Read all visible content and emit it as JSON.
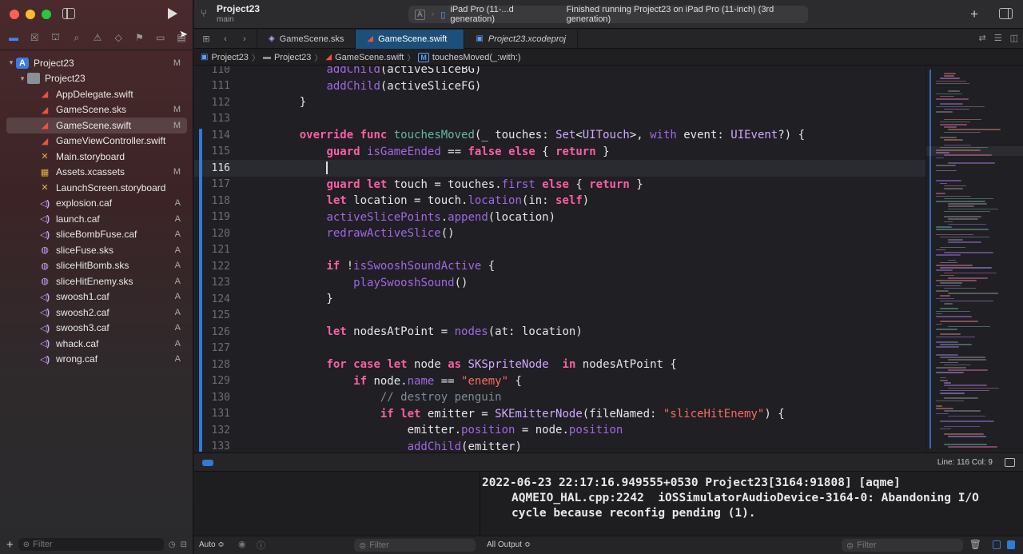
{
  "sidebar": {
    "tree": [
      {
        "label": "Project23",
        "status": "M",
        "icon": "project-icon",
        "level": 0
      },
      {
        "label": "Project23",
        "status": "",
        "icon": "folder-icon",
        "level": 1
      },
      {
        "label": "AppDelegate.swift",
        "status": "",
        "icon": "swift-file-icon",
        "level": 2
      },
      {
        "label": "GameScene.sks",
        "status": "M",
        "icon": "swift-file-icon",
        "level": 2
      },
      {
        "label": "GameScene.swift",
        "status": "M",
        "icon": "swift-file-icon",
        "level": 2,
        "selected": true
      },
      {
        "label": "GameViewController.swift",
        "status": "",
        "icon": "swift-file-icon",
        "level": 2
      },
      {
        "label": "Main.storyboard",
        "status": "",
        "icon": "storyboard-icon",
        "level": 2
      },
      {
        "label": "Assets.xcassets",
        "status": "M",
        "icon": "assets-icon",
        "level": 2
      },
      {
        "label": "LaunchScreen.storyboard",
        "status": "",
        "icon": "storyboard-icon",
        "level": 2
      },
      {
        "label": "explosion.caf",
        "status": "A",
        "icon": "audio-file-icon",
        "level": 2
      },
      {
        "label": "launch.caf",
        "status": "A",
        "icon": "audio-file-icon",
        "level": 2
      },
      {
        "label": "sliceBombFuse.caf",
        "status": "A",
        "icon": "audio-file-icon",
        "level": 2
      },
      {
        "label": "sliceFuse.sks",
        "status": "A",
        "icon": "particle-file-icon",
        "level": 2
      },
      {
        "label": "sliceHitBomb.sks",
        "status": "A",
        "icon": "particle-file-icon",
        "level": 2
      },
      {
        "label": "sliceHitEnemy.sks",
        "status": "A",
        "icon": "particle-file-icon",
        "level": 2
      },
      {
        "label": "swoosh1.caf",
        "status": "A",
        "icon": "audio-file-icon",
        "level": 2
      },
      {
        "label": "swoosh2.caf",
        "status": "A",
        "icon": "audio-file-icon",
        "level": 2
      },
      {
        "label": "swoosh3.caf",
        "status": "A",
        "icon": "audio-file-icon",
        "level": 2
      },
      {
        "label": "whack.caf",
        "status": "A",
        "icon": "audio-file-icon",
        "level": 2
      },
      {
        "label": "wrong.caf",
        "status": "A",
        "icon": "audio-file-icon",
        "level": 2
      }
    ],
    "filter_placeholder": "Filter"
  },
  "toolbar": {
    "project_name": "Project23",
    "branch": "main",
    "device": "iPad Pro (11-...d generation)",
    "activity_status": "Finished running Project23 on iPad Pro (11-inch) (3rd generation)"
  },
  "tabs": [
    {
      "label": "GameScene.sks",
      "active": false,
      "italic": false
    },
    {
      "label": "GameScene.swift",
      "active": true,
      "italic": false
    },
    {
      "label": "Project23.xcodeproj",
      "active": false,
      "italic": true
    }
  ],
  "breadcrumb": [
    "Project23",
    "Project23",
    "GameScene.swift",
    "touchesMoved(_:with:)"
  ],
  "editor": {
    "current_line": 116,
    "lines": [
      {
        "n": "110",
        "tokens": [
          [
            "        ",
            ""
          ],
          [
            "addChild",
            "fn"
          ],
          [
            "(activeSliceBG)",
            ""
          ]
        ]
      },
      {
        "n": "111",
        "tokens": [
          [
            "        ",
            ""
          ],
          [
            "addChild",
            "fn"
          ],
          [
            "(activeSliceFG)",
            ""
          ]
        ]
      },
      {
        "n": "112",
        "tokens": [
          [
            "    }",
            ""
          ]
        ]
      },
      {
        "n": "113",
        "tokens": []
      },
      {
        "n": "114",
        "tokens": [
          [
            "    ",
            ""
          ],
          [
            "override",
            "kw"
          ],
          [
            " ",
            ""
          ],
          [
            "func",
            "kw"
          ],
          [
            " ",
            ""
          ],
          [
            "touchesMoved",
            "dfn"
          ],
          [
            "(_ touches: ",
            ""
          ],
          [
            "Set",
            "type"
          ],
          [
            "<",
            ""
          ],
          [
            "UITouch",
            "type"
          ],
          [
            ">, ",
            ""
          ],
          [
            "with",
            "fn"
          ],
          [
            " event: ",
            ""
          ],
          [
            "UIEvent",
            "type"
          ],
          [
            "?) {",
            ""
          ]
        ]
      },
      {
        "n": "115",
        "tokens": [
          [
            "        ",
            ""
          ],
          [
            "guard",
            "kw"
          ],
          [
            " ",
            ""
          ],
          [
            "isGameEnded",
            "prop"
          ],
          [
            " == ",
            ""
          ],
          [
            "false",
            "kw"
          ],
          [
            " ",
            ""
          ],
          [
            "else",
            "kw"
          ],
          [
            " { ",
            ""
          ],
          [
            "return",
            "kw"
          ],
          [
            " }",
            ""
          ]
        ]
      },
      {
        "n": "116",
        "tokens": [
          [
            "        ",
            ""
          ]
        ],
        "caret": true
      },
      {
        "n": "117",
        "tokens": [
          [
            "        ",
            ""
          ],
          [
            "guard",
            "kw"
          ],
          [
            " ",
            ""
          ],
          [
            "let",
            "kw"
          ],
          [
            " touch = touches.",
            ""
          ],
          [
            "first",
            "prop"
          ],
          [
            " ",
            ""
          ],
          [
            "else",
            "kw"
          ],
          [
            " { ",
            ""
          ],
          [
            "return",
            "kw"
          ],
          [
            " }",
            ""
          ]
        ]
      },
      {
        "n": "118",
        "tokens": [
          [
            "        ",
            ""
          ],
          [
            "let",
            "kw"
          ],
          [
            " location = touch.",
            ""
          ],
          [
            "location",
            "prop"
          ],
          [
            "(in: ",
            ""
          ],
          [
            "self",
            "kw"
          ],
          [
            ")",
            ""
          ]
        ]
      },
      {
        "n": "119",
        "tokens": [
          [
            "        ",
            ""
          ],
          [
            "activeSlicePoints",
            "prop"
          ],
          [
            ".",
            ""
          ],
          [
            "append",
            "fn"
          ],
          [
            "(location)",
            ""
          ]
        ]
      },
      {
        "n": "120",
        "tokens": [
          [
            "        ",
            ""
          ],
          [
            "redrawActiveSlice",
            "fn"
          ],
          [
            "()",
            ""
          ]
        ]
      },
      {
        "n": "121",
        "tokens": []
      },
      {
        "n": "122",
        "tokens": [
          [
            "        ",
            ""
          ],
          [
            "if",
            "kw"
          ],
          [
            " !",
            ""
          ],
          [
            "isSwooshSoundActive",
            "prop"
          ],
          [
            " {",
            ""
          ]
        ]
      },
      {
        "n": "123",
        "tokens": [
          [
            "            ",
            ""
          ],
          [
            "playSwooshSound",
            "fn"
          ],
          [
            "()",
            ""
          ]
        ]
      },
      {
        "n": "124",
        "tokens": [
          [
            "        }",
            ""
          ]
        ]
      },
      {
        "n": "125",
        "tokens": []
      },
      {
        "n": "126",
        "tokens": [
          [
            "        ",
            ""
          ],
          [
            "let",
            "kw"
          ],
          [
            " nodesAtPoint = ",
            ""
          ],
          [
            "nodes",
            "fn"
          ],
          [
            "(at: location)",
            ""
          ]
        ]
      },
      {
        "n": "127",
        "tokens": []
      },
      {
        "n": "128",
        "tokens": [
          [
            "        ",
            ""
          ],
          [
            "for",
            "kw"
          ],
          [
            " ",
            ""
          ],
          [
            "case",
            "kw"
          ],
          [
            " ",
            ""
          ],
          [
            "let",
            "kw"
          ],
          [
            " node ",
            ""
          ],
          [
            "as",
            "kw"
          ],
          [
            " ",
            ""
          ],
          [
            "SKSpriteNode",
            "type"
          ],
          [
            "  ",
            ""
          ],
          [
            "in",
            "kw"
          ],
          [
            " nodesAtPoint {",
            ""
          ]
        ]
      },
      {
        "n": "129",
        "tokens": [
          [
            "            ",
            ""
          ],
          [
            "if",
            "kw"
          ],
          [
            " node.",
            ""
          ],
          [
            "name",
            "prop"
          ],
          [
            " == ",
            ""
          ],
          [
            "\"enemy\"",
            "str"
          ],
          [
            " {",
            ""
          ]
        ]
      },
      {
        "n": "130",
        "tokens": [
          [
            "                ",
            ""
          ],
          [
            "// destroy penguin",
            "cm"
          ]
        ]
      },
      {
        "n": "131",
        "tokens": [
          [
            "                ",
            ""
          ],
          [
            "if",
            "kw"
          ],
          [
            " ",
            ""
          ],
          [
            "let",
            "kw"
          ],
          [
            " emitter = ",
            ""
          ],
          [
            "SKEmitterNode",
            "type"
          ],
          [
            "(fileNamed: ",
            ""
          ],
          [
            "\"sliceHitEnemy\"",
            "str"
          ],
          [
            ") {",
            ""
          ]
        ]
      },
      {
        "n": "132",
        "tokens": [
          [
            "                    ",
            ""
          ],
          [
            "emitter.",
            ""
          ],
          [
            "position",
            "prop"
          ],
          [
            " = node.",
            ""
          ],
          [
            "position",
            "prop"
          ]
        ]
      },
      {
        "n": "133",
        "tokens": [
          [
            "                    ",
            ""
          ],
          [
            "addChild",
            "fn"
          ],
          [
            "(emitter)",
            ""
          ]
        ]
      }
    ]
  },
  "status": {
    "position": "Line: 116  Col: 9"
  },
  "debug": {
    "auto_label": "Auto ≎",
    "filter_placeholder": "Filter",
    "output_label": "All Output ≎",
    "console_lines": [
      "2022-06-23 22:17:16.949555+0530 Project23[3164:91808] [aqme]",
      "AQMEIO_HAL.cpp:2242  iOSSimulatorAudioDevice-3164-0: Abandoning I/O",
      "cycle because reconfig pending (1)."
    ]
  },
  "colors": {
    "accent": "#2e7bdc",
    "keyword": "#fc5fa3",
    "function": "#a167e6",
    "type": "#d0a8ff",
    "string": "#fc6a5d",
    "comment": "#7f8c98"
  }
}
